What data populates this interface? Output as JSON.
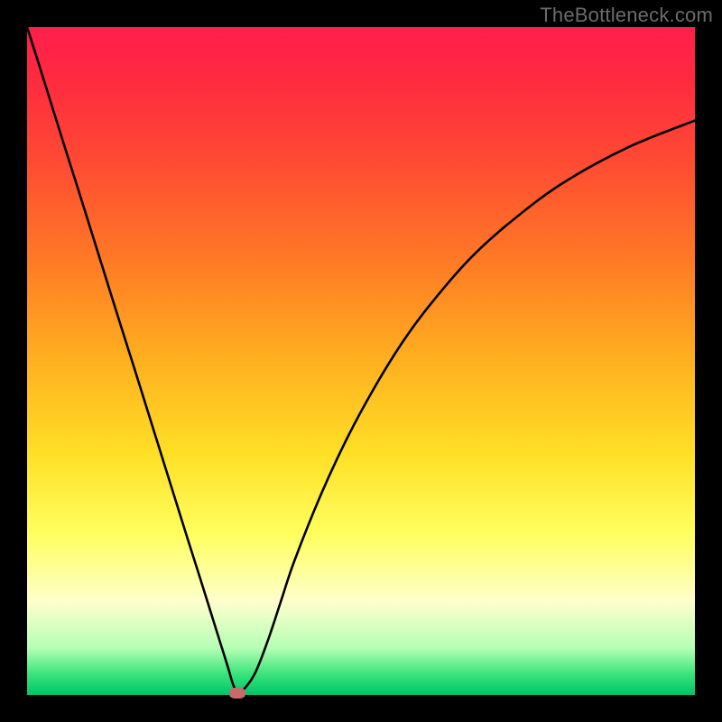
{
  "watermark": {
    "text": "TheBottleneck.com"
  },
  "chart_data": {
    "type": "line",
    "title": "",
    "xlabel": "",
    "ylabel": "",
    "xlim": [
      0,
      100
    ],
    "ylim": [
      0,
      100
    ],
    "grid": false,
    "legend": false,
    "background_gradient": {
      "direction": "vertical",
      "stops": [
        {
          "pos": 0,
          "color": "#ff1e4d"
        },
        {
          "pos": 20,
          "color": "#ff4a33"
        },
        {
          "pos": 50,
          "color": "#ffb01f"
        },
        {
          "pos": 76,
          "color": "#ffff60"
        },
        {
          "pos": 93,
          "color": "#b5ffb5"
        },
        {
          "pos": 100,
          "color": "#00c46a"
        }
      ]
    },
    "series": [
      {
        "name": "bottleneck-curve",
        "color": "#000000",
        "x": [
          0,
          2,
          4,
          6,
          8,
          10,
          12,
          14,
          16,
          18,
          20,
          22,
          24,
          26,
          28,
          30,
          31,
          32,
          34,
          36,
          38,
          40,
          44,
          48,
          52,
          56,
          60,
          66,
          72,
          80,
          90,
          100
        ],
        "y": [
          100,
          93.7,
          87.3,
          80.9,
          74.6,
          68.2,
          61.8,
          55.4,
          49.1,
          42.7,
          36.3,
          29.9,
          23.5,
          17.2,
          10.8,
          4.4,
          1.2,
          0.5,
          3.0,
          8.0,
          14.0,
          20.0,
          30.0,
          38.6,
          46.0,
          52.5,
          58.0,
          65.0,
          70.5,
          76.5,
          82.0,
          86.0
        ]
      }
    ],
    "marker": {
      "x": 31.5,
      "y": 0.3,
      "color": "#c76a6a"
    }
  }
}
